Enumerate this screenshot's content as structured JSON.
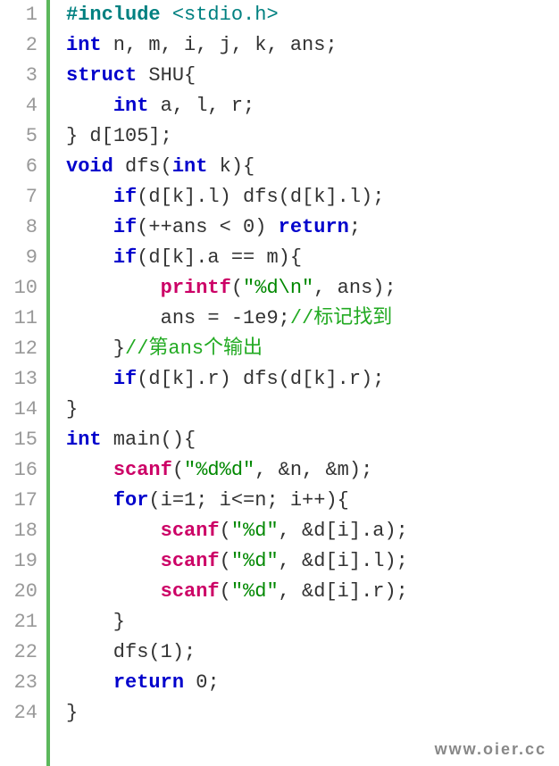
{
  "watermark": "www.oier.cc",
  "lines": [
    {
      "num": "1",
      "tokens": [
        {
          "t": "#include",
          "c": "pp"
        },
        {
          "t": " ",
          "c": ""
        },
        {
          "t": "<stdio.h>",
          "c": "pph"
        }
      ]
    },
    {
      "num": "2",
      "tokens": [
        {
          "t": "int",
          "c": "kw"
        },
        {
          "t": " n, m, i, j, k, ans;",
          "c": ""
        }
      ]
    },
    {
      "num": "3",
      "tokens": [
        {
          "t": "struct",
          "c": "kw"
        },
        {
          "t": " SHU{",
          "c": ""
        }
      ]
    },
    {
      "num": "4",
      "tokens": [
        {
          "t": "    ",
          "c": ""
        },
        {
          "t": "int",
          "c": "kw"
        },
        {
          "t": " a, l, r;",
          "c": ""
        }
      ]
    },
    {
      "num": "5",
      "tokens": [
        {
          "t": "} d[",
          "c": ""
        },
        {
          "t": "105",
          "c": "num"
        },
        {
          "t": "];",
          "c": ""
        }
      ]
    },
    {
      "num": "6",
      "tokens": [
        {
          "t": "void",
          "c": "kw"
        },
        {
          "t": " dfs(",
          "c": ""
        },
        {
          "t": "int",
          "c": "kw"
        },
        {
          "t": " k){",
          "c": ""
        }
      ]
    },
    {
      "num": "7",
      "tokens": [
        {
          "t": "    ",
          "c": ""
        },
        {
          "t": "if",
          "c": "kw"
        },
        {
          "t": "(d[k].l) dfs(d[k].l);",
          "c": ""
        }
      ]
    },
    {
      "num": "8",
      "tokens": [
        {
          "t": "    ",
          "c": ""
        },
        {
          "t": "if",
          "c": "kw"
        },
        {
          "t": "(++ans < ",
          "c": ""
        },
        {
          "t": "0",
          "c": "num"
        },
        {
          "t": ") ",
          "c": ""
        },
        {
          "t": "return",
          "c": "kw"
        },
        {
          "t": ";",
          "c": ""
        }
      ]
    },
    {
      "num": "9",
      "tokens": [
        {
          "t": "    ",
          "c": ""
        },
        {
          "t": "if",
          "c": "kw"
        },
        {
          "t": "(d[k].a == m){",
          "c": ""
        }
      ]
    },
    {
      "num": "10",
      "tokens": [
        {
          "t": "        ",
          "c": ""
        },
        {
          "t": "printf",
          "c": "fn"
        },
        {
          "t": "(",
          "c": ""
        },
        {
          "t": "\"%d\\n\"",
          "c": "str"
        },
        {
          "t": ", ans);",
          "c": ""
        }
      ]
    },
    {
      "num": "11",
      "tokens": [
        {
          "t": "        ans = -",
          "c": ""
        },
        {
          "t": "1e9",
          "c": "num"
        },
        {
          "t": ";",
          "c": ""
        },
        {
          "t": "//标记找到",
          "c": "cm"
        }
      ]
    },
    {
      "num": "12",
      "tokens": [
        {
          "t": "    }",
          "c": ""
        },
        {
          "t": "//第ans个输出",
          "c": "cm"
        }
      ]
    },
    {
      "num": "13",
      "tokens": [
        {
          "t": "    ",
          "c": ""
        },
        {
          "t": "if",
          "c": "kw"
        },
        {
          "t": "(d[k].r) dfs(d[k].r);",
          "c": ""
        }
      ]
    },
    {
      "num": "14",
      "tokens": [
        {
          "t": "}",
          "c": ""
        }
      ]
    },
    {
      "num": "15",
      "tokens": [
        {
          "t": "int",
          "c": "kw"
        },
        {
          "t": " main(){",
          "c": ""
        }
      ]
    },
    {
      "num": "16",
      "tokens": [
        {
          "t": "    ",
          "c": ""
        },
        {
          "t": "scanf",
          "c": "fn"
        },
        {
          "t": "(",
          "c": ""
        },
        {
          "t": "\"%d%d\"",
          "c": "str"
        },
        {
          "t": ", &n, &m);",
          "c": ""
        }
      ]
    },
    {
      "num": "17",
      "tokens": [
        {
          "t": "    ",
          "c": ""
        },
        {
          "t": "for",
          "c": "kw"
        },
        {
          "t": "(i=",
          "c": ""
        },
        {
          "t": "1",
          "c": "num"
        },
        {
          "t": "; i<=n; i++){",
          "c": ""
        }
      ]
    },
    {
      "num": "18",
      "tokens": [
        {
          "t": "        ",
          "c": ""
        },
        {
          "t": "scanf",
          "c": "fn"
        },
        {
          "t": "(",
          "c": ""
        },
        {
          "t": "\"%d\"",
          "c": "str"
        },
        {
          "t": ", &d[i].a);",
          "c": ""
        }
      ]
    },
    {
      "num": "19",
      "tokens": [
        {
          "t": "        ",
          "c": ""
        },
        {
          "t": "scanf",
          "c": "fn"
        },
        {
          "t": "(",
          "c": ""
        },
        {
          "t": "\"%d\"",
          "c": "str"
        },
        {
          "t": ", &d[i].l);",
          "c": ""
        }
      ]
    },
    {
      "num": "20",
      "tokens": [
        {
          "t": "        ",
          "c": ""
        },
        {
          "t": "scanf",
          "c": "fn"
        },
        {
          "t": "(",
          "c": ""
        },
        {
          "t": "\"%d\"",
          "c": "str"
        },
        {
          "t": ", &d[i].r);",
          "c": ""
        }
      ]
    },
    {
      "num": "21",
      "tokens": [
        {
          "t": "    }",
          "c": ""
        }
      ]
    },
    {
      "num": "22",
      "tokens": [
        {
          "t": "    dfs(",
          "c": ""
        },
        {
          "t": "1",
          "c": "num"
        },
        {
          "t": ");",
          "c": ""
        }
      ]
    },
    {
      "num": "23",
      "tokens": [
        {
          "t": "    ",
          "c": ""
        },
        {
          "t": "return",
          "c": "kw"
        },
        {
          "t": " ",
          "c": ""
        },
        {
          "t": "0",
          "c": "num"
        },
        {
          "t": ";",
          "c": ""
        }
      ]
    },
    {
      "num": "24",
      "tokens": [
        {
          "t": "}",
          "c": ""
        }
      ]
    }
  ]
}
